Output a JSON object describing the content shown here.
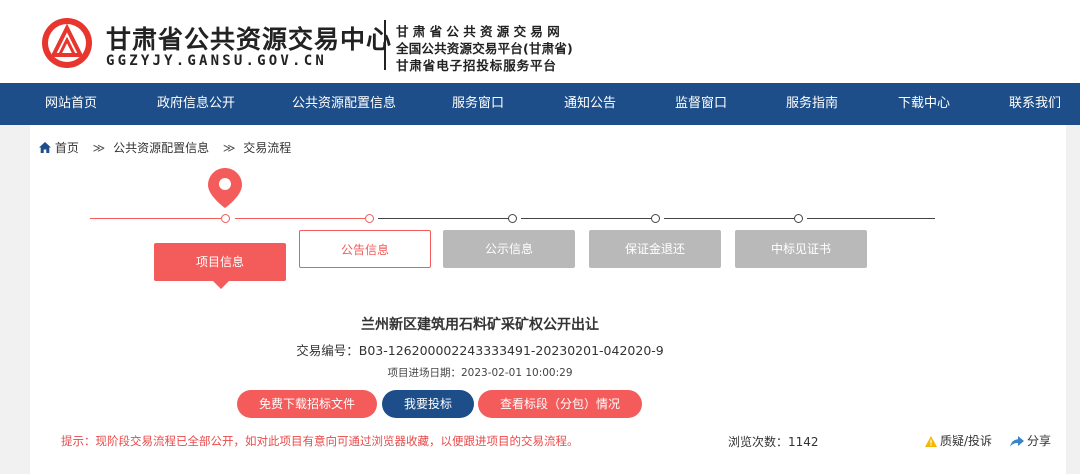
{
  "header": {
    "title": "甘肃省公共资源交易中心",
    "domain": "GGZYJY.GANSU.GOV.CN",
    "sub_lines": [
      "甘肃省公共资源交易网",
      "全国公共资源交易平台(甘肃省)",
      "甘肃省电子招投标服务平台"
    ],
    "logo_color": "#e8352e"
  },
  "nav": {
    "items": [
      "网站首页",
      "政府信息公开",
      "公共资源配置信息",
      "服务窗口",
      "通知公告",
      "监督窗口",
      "服务指南",
      "下载中心",
      "联系我们"
    ],
    "color": "#1d4e89"
  },
  "breadcrumb": {
    "home": "首页",
    "level1": "公共资源配置信息",
    "level2": "交易流程"
  },
  "steps": [
    {
      "label": "项目信息",
      "state": "active"
    },
    {
      "label": "公告信息",
      "state": "done"
    },
    {
      "label": "公示信息",
      "state": "pending"
    },
    {
      "label": "保证金退还",
      "state": "pending"
    },
    {
      "label": "中标见证书",
      "state": "pending"
    }
  ],
  "project": {
    "title": "兰州新区建筑用石料矿采矿权公开出让",
    "code_label": "交易编号：",
    "code": "B03-126200002243333491-20230201-042020-9",
    "date_label": "项目进场日期：",
    "date": "2023-02-01 10:00:29"
  },
  "actions": {
    "download": "免费下载招标文件",
    "bid": "我要投标",
    "sections": "查看标段（分包）情况"
  },
  "footer": {
    "tip": "提示：现阶段交易流程已全部公开，如对此项目有意向可通过浏览器收藏，以便跟进项目的交易流程。",
    "views_label": "浏览次数：",
    "views": "1142",
    "report": "质疑/投诉",
    "share": "分享"
  },
  "colors": {
    "accent_red": "#f45b5b",
    "nav_blue": "#1d4e89",
    "bid_button": "#1d4e89",
    "pending_gray": "#b9b9b9"
  }
}
